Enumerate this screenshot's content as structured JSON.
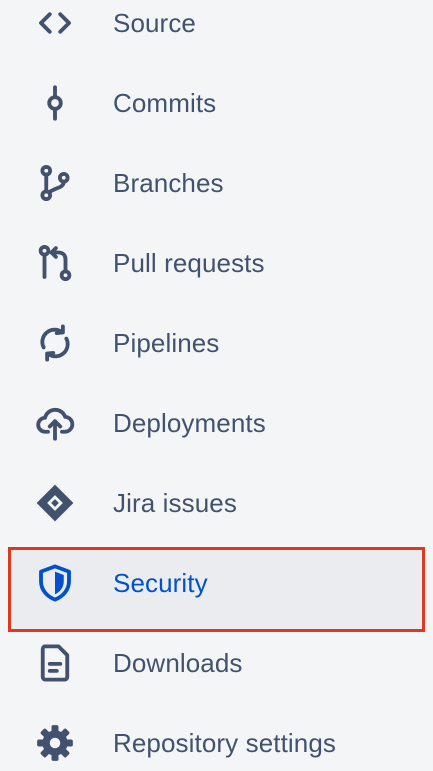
{
  "sidebar": {
    "items": [
      {
        "label": "Source",
        "icon": "code-icon"
      },
      {
        "label": "Commits",
        "icon": "commit-icon"
      },
      {
        "label": "Branches",
        "icon": "branch-icon"
      },
      {
        "label": "Pull requests",
        "icon": "pull-request-icon"
      },
      {
        "label": "Pipelines",
        "icon": "pipelines-icon"
      },
      {
        "label": "Deployments",
        "icon": "cloud-upload-icon"
      },
      {
        "label": "Jira issues",
        "icon": "jira-icon"
      },
      {
        "label": "Security",
        "icon": "shield-icon",
        "active": true
      },
      {
        "label": "Downloads",
        "icon": "document-icon"
      },
      {
        "label": "Repository settings",
        "icon": "gear-icon"
      }
    ]
  },
  "colors": {
    "text": "#42526e",
    "active_text": "#0052cc",
    "active_bg": "#ebecf0",
    "highlight_border": "#e0371f",
    "background": "#f4f5f7"
  }
}
